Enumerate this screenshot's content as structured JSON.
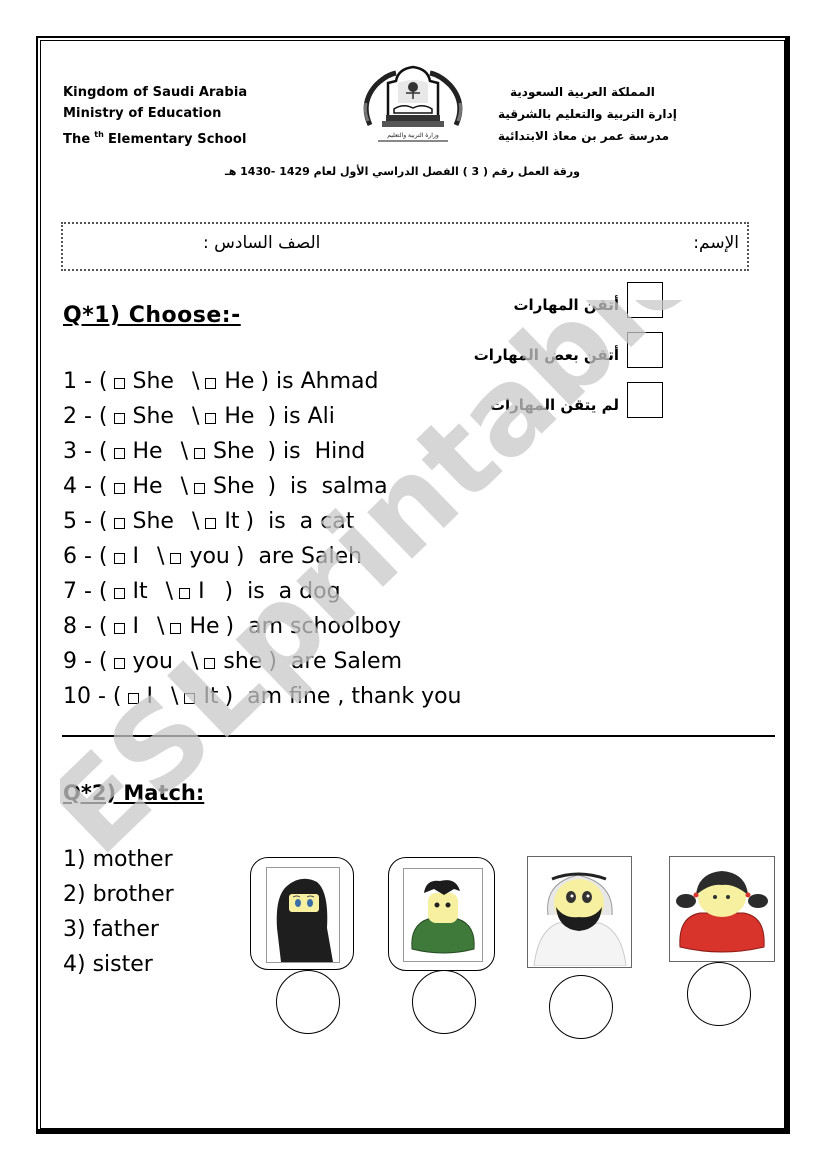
{
  "header": {
    "left_lines": [
      "Kingdom of Saudi Arabia",
      "Ministry of Education",
      "The",
      "th",
      "Elementary School"
    ],
    "right_lines": [
      "المملكة العربية السعودية",
      "إدارة التربية والتعليم بالشرقية",
      "مدرسة عمر بن معاذ  الابتدائية"
    ],
    "logo_icon": "ministry-of-education-logo",
    "worksheet_line": "ورقة العمل رقم ( 3 ) الفصل الدراسي الأول لعام  1429 -1430 هـ"
  },
  "student_box": {
    "name_label": "الإسم:",
    "class_label": "الصف السادس :"
  },
  "skills": [
    {
      "label": "أتقن المهارات"
    },
    {
      "label": "أتقن بعض المهارات"
    },
    {
      "label": "لم يتقن المهارات"
    }
  ],
  "q1": {
    "title": "Q*1)  Choose:-",
    "items": [
      {
        "num": "1 - (",
        "opt1": "She",
        "sep": "\\",
        "opt2": "He",
        "close": ") is Ahmad"
      },
      {
        "num": "2 - (",
        "opt1": "She",
        "sep": "\\",
        "opt2": "He",
        "close": " ) is Ali"
      },
      {
        "num": "3 - (",
        "opt1": "He",
        "sep": "\\",
        "opt2": "She",
        "close": " ) is  Hind"
      },
      {
        "num": "4 - (",
        "opt1": "He",
        "sep": "\\",
        "opt2": "She",
        "close": " )  is  salma"
      },
      {
        "num": "5 - (",
        "opt1": "She",
        "sep": "\\",
        "opt2": "It",
        "close": ")  is  a cat"
      },
      {
        "num": "6 - (",
        "opt1": "I",
        "sep": "\\",
        "opt2": "you",
        "close": ")  are Saleh"
      },
      {
        "num": "7 - (",
        "opt1": "It",
        "sep": "\\",
        "opt2": "I",
        "close": "  )  is  a dog"
      },
      {
        "num": "8 - (",
        "opt1": "I",
        "sep": "\\",
        "opt2": "He",
        "close": ")  am schoolboy"
      },
      {
        "num": "9 - (",
        "opt1": "you",
        "sep": "\\",
        "opt2": "she",
        "close": ")  are Salem"
      },
      {
        "num": "10 - (",
        "opt1": "I",
        "sep": "\\",
        "opt2": "It",
        "close": ")  am fine , thank you"
      }
    ]
  },
  "q2": {
    "title": "Q*2) Match:",
    "words": [
      "1) mother",
      "2) brother",
      "3) father",
      "4) sister"
    ],
    "pictures": [
      {
        "icon": "veiled-woman-picture",
        "depicts": "mother"
      },
      {
        "icon": "boy-green-sweater-picture",
        "depicts": "brother"
      },
      {
        "icon": "man-ghutra-beard-picture",
        "depicts": "father"
      },
      {
        "icon": "girl-pigtails-red-picture",
        "depicts": "sister"
      }
    ]
  },
  "watermark": "ESLprintables.com",
  "colors": {
    "text": "#000000",
    "watermark": "#c8c8c8",
    "sweater_green": "#3f7a3a",
    "dress_red": "#d9342b",
    "skin": "#f6f0a0"
  }
}
